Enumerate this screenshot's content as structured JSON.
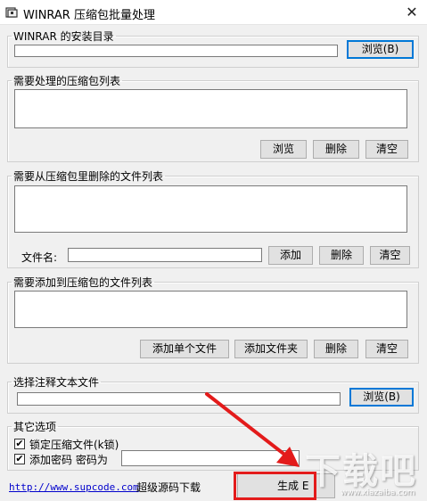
{
  "window": {
    "title": "WINRAR 压缩包批量处理",
    "close_glyph": "✕"
  },
  "install_dir": {
    "legend": "WINRAR 的安装目录",
    "value": "",
    "browse_label": "浏览(B)"
  },
  "archives": {
    "legend": "需要处理的压缩包列表",
    "browse_label": "浏览",
    "delete_label": "删除",
    "clear_label": "清空"
  },
  "delete_files": {
    "legend": "需要从压缩包里删除的文件列表",
    "filename_label": "文件名:",
    "filename_value": "",
    "add_label": "添加",
    "delete_label": "删除",
    "clear_label": "清空"
  },
  "add_files": {
    "legend": "需要添加到压缩包的文件列表",
    "add_file_label": "添加单个文件",
    "add_folder_label": "添加文件夹",
    "delete_label": "删除",
    "clear_label": "清空"
  },
  "comment": {
    "legend": "选择注释文本文件",
    "value": "",
    "browse_label": "浏览(B)"
  },
  "options": {
    "legend": "其它选项",
    "lock_label": "锁定压缩文件(k锁)",
    "lock_checked": true,
    "password_label": "添加密码  密码为",
    "password_checked": true,
    "password_value": ""
  },
  "footer": {
    "link_text": "http://www.supcode.com",
    "download_text": "超级源码下载",
    "generate_label": "生成 E"
  },
  "annotation": {
    "arrow_color": "#e31b1b"
  },
  "watermark": {
    "text": "下载吧",
    "site": "www.xiazaiba.com"
  },
  "icons": {
    "app": "winrar-app-icon",
    "close": "close-icon",
    "check": "checkmark-icon"
  }
}
